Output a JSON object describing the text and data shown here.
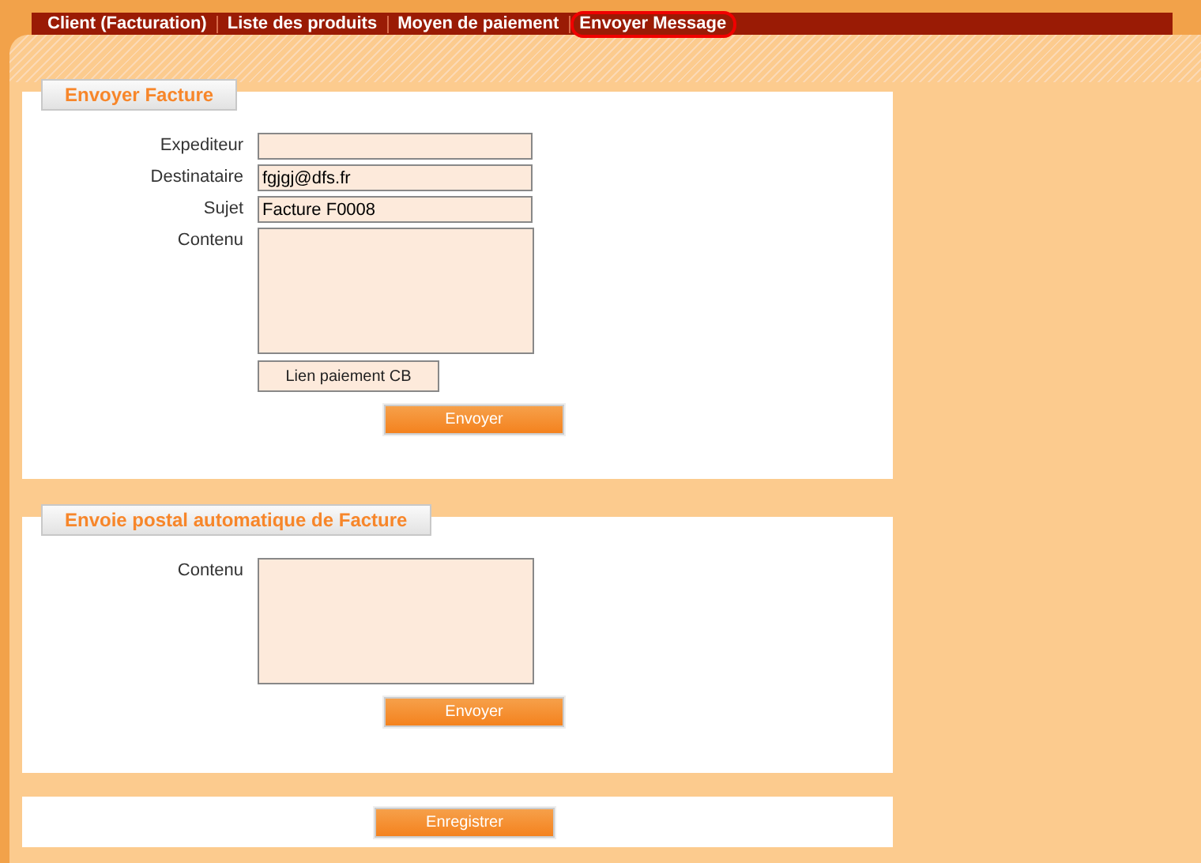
{
  "tabs": [
    {
      "label": "Client (Facturation)",
      "selected": false
    },
    {
      "label": "Liste des produits",
      "selected": false
    },
    {
      "label": "Moyen de paiement",
      "selected": false
    },
    {
      "label": "Envoyer Message",
      "selected": true
    }
  ],
  "sections": [
    {
      "title": "Envoyer Facture",
      "fields": [
        {
          "kind": "input",
          "label": "Expediteur"
        },
        {
          "kind": "input",
          "label": "Destinataire",
          "value": "fgjgj@dfs.fr"
        },
        {
          "kind": "input",
          "label": "Sujet",
          "value": "Facture F0008"
        },
        {
          "kind": "textarea",
          "label": "Contenu"
        },
        {
          "kind": "link-button",
          "text": "Lien paiement CB"
        }
      ],
      "button": "Envoyer"
    },
    {
      "title": "Envoie postal automatique de Facture",
      "fields": [
        {
          "kind": "textarea",
          "label": "Contenu"
        }
      ],
      "button": "Envoyer"
    }
  ],
  "save_button": "Enregistrer"
}
